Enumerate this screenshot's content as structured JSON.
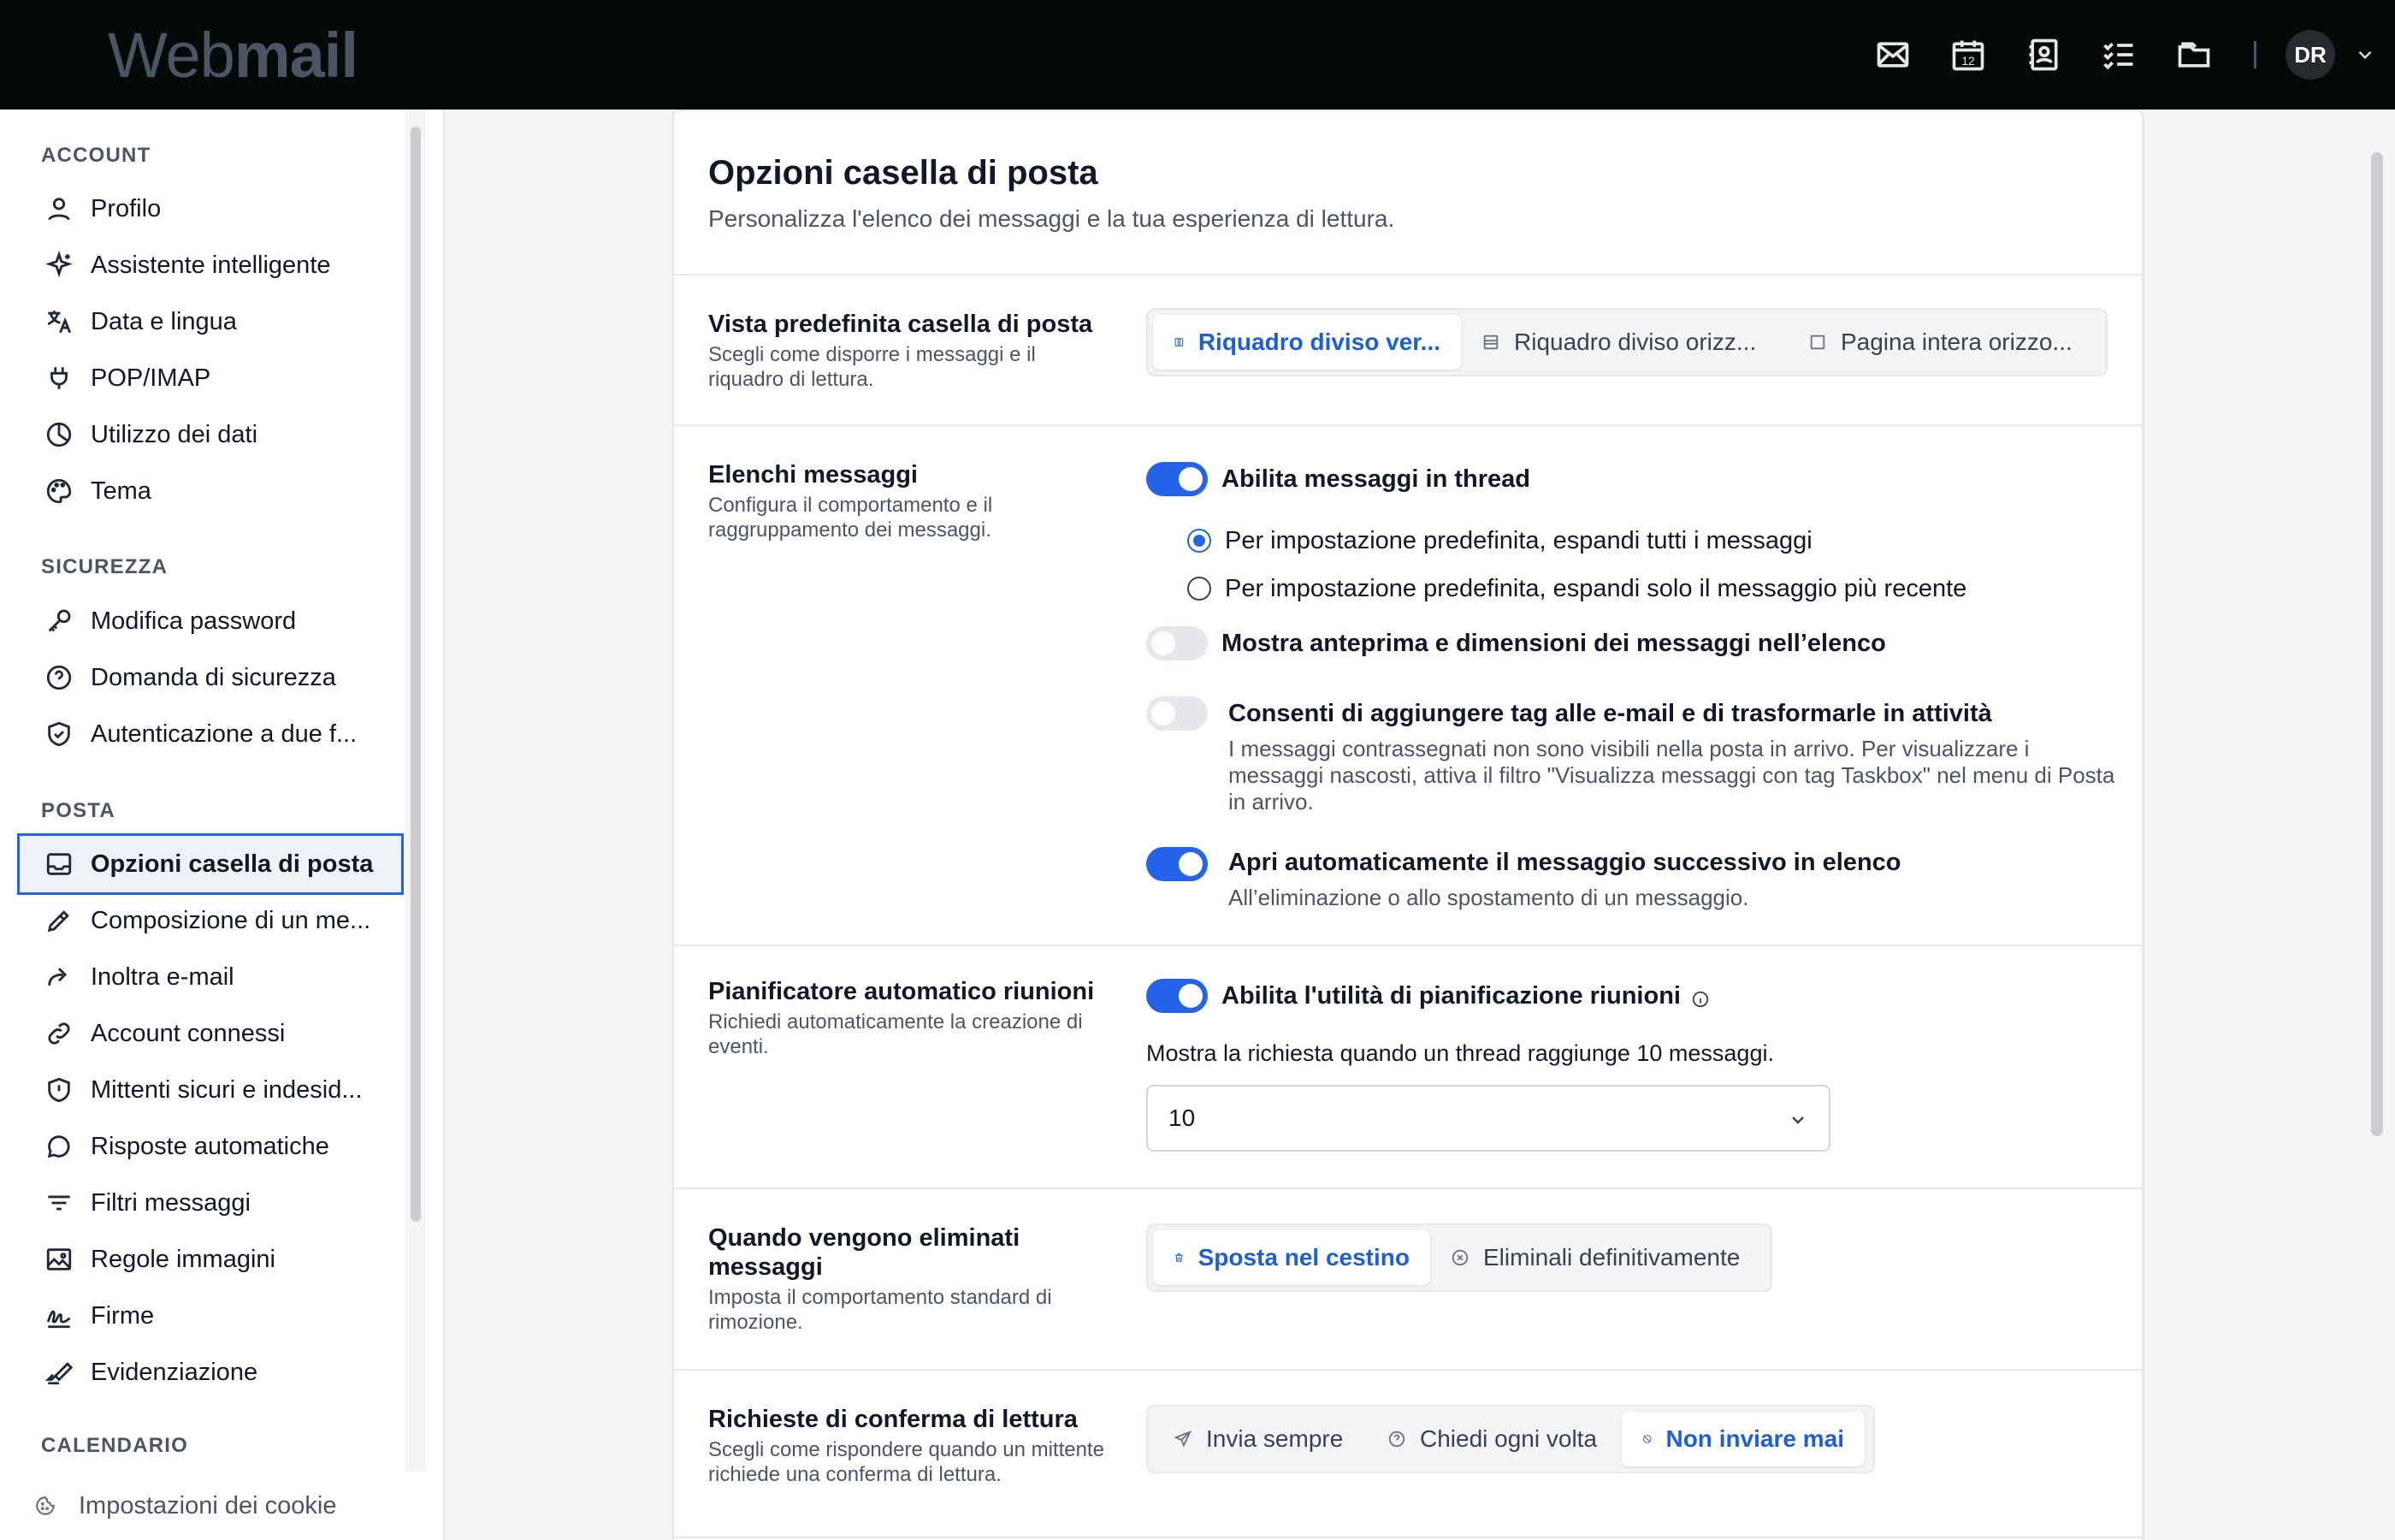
{
  "app": {
    "logo_light": "Web",
    "logo_bold": "mail"
  },
  "topbar": {
    "icons": [
      "mail-icon",
      "calendar-icon",
      "contacts-icon",
      "tasks-icon",
      "folder-icon"
    ],
    "calendar_day": "12",
    "avatar_initials": "DR"
  },
  "sidebar": {
    "sections": {
      "account": "ACCOUNT",
      "security": "SICUREZZA",
      "mail": "POSTA",
      "calendar": "CALENDARIO"
    },
    "account_items": [
      "Profilo",
      "Assistente intelligente",
      "Data e lingua",
      "POP/IMAP",
      "Utilizzo dei dati",
      "Tema"
    ],
    "security_items": [
      "Modifica password",
      "Domanda di sicurezza",
      "Autenticazione a due f..."
    ],
    "mail_items": [
      "Opzioni casella di posta",
      "Composizione di un me...",
      "Inoltra e-mail",
      "Account connessi",
      "Mittenti sicuri e indesid...",
      "Risposte automatiche",
      "Filtri messaggi",
      "Regole immagini",
      "Firme",
      "Evidenziazione"
    ],
    "active_item": "Opzioni casella di posta",
    "cookie_settings": "Impostazioni dei cookie"
  },
  "main": {
    "title": "Opzioni casella di posta",
    "subtitle": "Personalizza l'elenco dei messaggi e la tua esperienza di lettura.",
    "view": {
      "title": "Vista predefinita casella di posta",
      "desc": "Scegli come disporre i messaggi e il riquadro di lettura.",
      "options": [
        "Riquadro diviso ver...",
        "Riquadro diviso orizz...",
        "Pagina intera orizzo..."
      ],
      "selected": 0
    },
    "lists": {
      "title": "Elenchi messaggi",
      "desc": "Configura il comportamento e il raggruppamento dei messaggi.",
      "threading_label": "Abilita messaggi in thread",
      "threading_on": true,
      "radio_expand_all": "Per impostazione predefinita, espandi tutti i messaggi",
      "radio_expand_recent": "Per impostazione predefinita, espandi solo il messaggio più recente",
      "radio_selected": "expand_all",
      "preview_label": "Mostra anteprima e dimensioni dei messaggi nell’elenco",
      "preview_on": false,
      "tags_label": "Consenti di aggiungere tag alle e-mail e di trasformarle in attività",
      "tags_on": false,
      "tags_desc": "I messaggi contrassegnati non sono visibili nella posta in arrivo. Per visualizzare i messaggi nascosti, attiva il filtro \"Visualizza messaggi con tag Taskbox\" nel menu di Posta in arrivo.",
      "autonext_label": "Apri automaticamente il messaggio successivo in elenco",
      "autonext_on": true,
      "autonext_desc": "All’eliminazione o allo spostamento di un messaggio."
    },
    "scheduler": {
      "title": "Pianificatore automatico riunioni",
      "desc": "Richiedi automaticamente la creazione di eventi.",
      "toggle_label": "Abilita l'utilità di pianificazione riunioni",
      "toggle_on": true,
      "prompt_text": "Mostra la richiesta quando un thread raggiunge 10 messaggi.",
      "select_value": "10"
    },
    "delete": {
      "title": "Quando vengono eliminati messaggi",
      "desc": "Imposta il comportamento standard di rimozione.",
      "options": [
        "Sposta nel cestino",
        "Eliminali definitivamente"
      ],
      "selected": 0
    },
    "receipts": {
      "title": "Richieste di conferma di lettura",
      "desc": "Scegli come rispondere quando un mittente richiede una conferma di lettura.",
      "options": [
        "Invia sempre",
        "Chiedi ogni volta",
        "Non inviare mai"
      ],
      "selected": 2
    }
  },
  "colors": {
    "accent": "#2563eb",
    "topbar": "#030a07",
    "selected_text": "#1d5fd6"
  }
}
